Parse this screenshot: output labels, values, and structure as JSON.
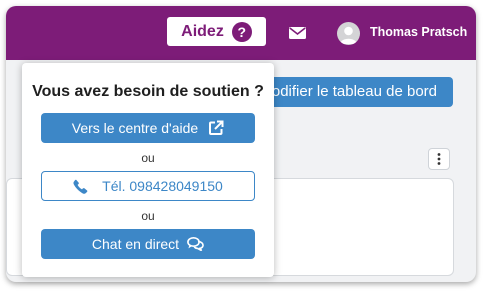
{
  "colors": {
    "brand": "#7d1c78",
    "accent": "#3d87c7"
  },
  "header": {
    "help_label": "Aidez",
    "help_icon_glyph": "?",
    "help_icon": "question-circle-icon",
    "mail_icon": "envelope-icon",
    "avatar_icon": "user-avatar-icon",
    "user_name": "Thomas Pratsch"
  },
  "main": {
    "customize_label": "odifier le tableau de bord",
    "menu_icon": "vertical-dots-icon"
  },
  "support_popover": {
    "title": "Vous avez besoin de soutien ?",
    "help_center_label": "Vers le centre d'aide",
    "help_center_icon": "external-link-icon",
    "or_1": "ou",
    "phone_label": "Tél. 098428049150",
    "phone_icon": "phone-icon",
    "or_2": "ou",
    "chat_label": "Chat en direct",
    "chat_icon": "chat-bubbles-icon"
  }
}
